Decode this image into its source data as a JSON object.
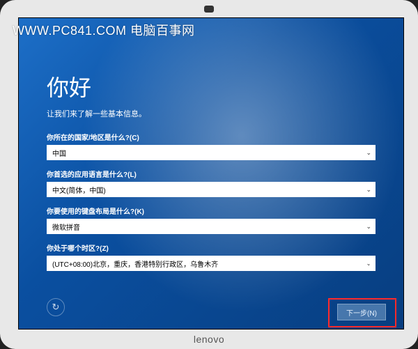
{
  "watermark": "WWW.PC841.COM 电脑百事网",
  "laptop_brand": "lenovo",
  "header": {
    "title": "你好",
    "subtitle": "让我们来了解一些基本信息。"
  },
  "fields": {
    "country": {
      "label": "你所在的国家/地区是什么?(C)",
      "value": "中国"
    },
    "language": {
      "label": "你首选的应用语言是什么?(L)",
      "value": "中文(简体，中国)"
    },
    "keyboard": {
      "label": "你要使用的键盘布局是什么?(K)",
      "value": "微软拼音"
    },
    "timezone": {
      "label": "你处于哪个时区?(Z)",
      "value": "(UTC+08:00)北京，重庆，香港特别行政区，乌鲁木齐"
    }
  },
  "buttons": {
    "next": "下一步(N)"
  },
  "icons": {
    "chevron": "⌄",
    "ease": "↻",
    "cursor": "➤"
  }
}
